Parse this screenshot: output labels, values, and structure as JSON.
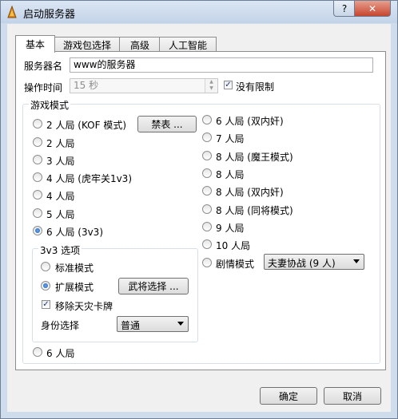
{
  "window": {
    "title": "启动服务器",
    "help_label": "?",
    "close_label": "✕"
  },
  "tabs": [
    {
      "label": "基本",
      "active": true
    },
    {
      "label": "游戏包选择"
    },
    {
      "label": "高级"
    },
    {
      "label": "人工智能"
    }
  ],
  "server_name": {
    "label": "服务器名",
    "value": "www的服务器"
  },
  "op_time": {
    "label": "操作时间",
    "value": "15 秒",
    "no_limit_label": "没有限制",
    "no_limit_checked": true
  },
  "game_mode": {
    "legend": "游戏模式",
    "left": [
      {
        "label": "2 人局 (KOF 模式)",
        "selected": false
      },
      {
        "label": "2 人局",
        "selected": false
      },
      {
        "label": "3 人局",
        "selected": false
      },
      {
        "label": "4 人局 (虎牢关1v3)",
        "selected": false
      },
      {
        "label": "4 人局",
        "selected": false
      },
      {
        "label": "5 人局",
        "selected": false
      },
      {
        "label": "6 人局 (3v3)",
        "selected": true
      }
    ],
    "ban_button": "禁表 ...",
    "right": [
      {
        "label": "6 人局 (双内奸)",
        "selected": false
      },
      {
        "label": "7 人局",
        "selected": false
      },
      {
        "label": "8 人局 (魔王模式)",
        "selected": false
      },
      {
        "label": "8 人局",
        "selected": false
      },
      {
        "label": "8 人局 (双内奸)",
        "selected": false
      },
      {
        "label": "8 人局 (同将模式)",
        "selected": false
      },
      {
        "label": "9 人局",
        "selected": false
      },
      {
        "label": "10 人局",
        "selected": false
      }
    ],
    "scenario": {
      "label": "剧情模式",
      "selected": false,
      "value": "夫妻协战 (9 人)"
    },
    "bottom": {
      "label": "6 人局",
      "selected": false
    }
  },
  "v3v3": {
    "legend": "3v3 选项",
    "standard": {
      "label": "标准模式",
      "selected": false
    },
    "extended": {
      "label": "扩展模式",
      "selected": true
    },
    "general_button": "武将选择 ...",
    "remove_card": {
      "label": "移除天灾卡牌",
      "checked": true
    },
    "role": {
      "label": "身份选择",
      "value": "普通"
    }
  },
  "footer": {
    "ok": "确定",
    "cancel": "取消"
  }
}
